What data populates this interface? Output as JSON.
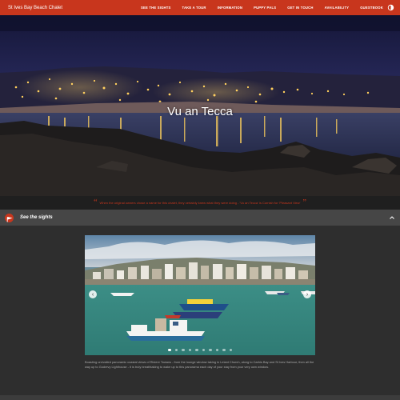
{
  "site": {
    "title": "St Ives Bay Beach Chalet",
    "accent_color": "#c8361d"
  },
  "nav": {
    "items": [
      {
        "label": "See the sights"
      },
      {
        "label": "Take a tour"
      },
      {
        "label": "Information"
      },
      {
        "label": "Puppy Pals"
      },
      {
        "label": "Get in touch"
      },
      {
        "label": "Availability"
      },
      {
        "label": "Guestbook"
      }
    ],
    "theme_icon": "moon-sun-icon"
  },
  "hero": {
    "title": "Vu an Tecca"
  },
  "quote": {
    "text": "When the original owners chose a name for this chalet, they certainly knew what they were doing - 'Vu an Tecca' is Cornish for 'Pleasant View'"
  },
  "section": {
    "title": "See the sights",
    "icon": "flag-icon",
    "collapse_icon": "chevron-up-icon"
  },
  "carousel": {
    "slide_count": 10,
    "active_index": 0,
    "prev_icon": "chevron-left-icon",
    "next_icon": "chevron-right-icon",
    "description": "Boasting unrivalled panoramic coastal views of Riviere Towans - from the lounge window taking in Lelant Church, along to Carbis Bay and St Ives Harbour, then all the way up to Godrevy Lighthouse - it is truly breathtaking to wake up to this panorama each day of your stay from your very own window."
  }
}
